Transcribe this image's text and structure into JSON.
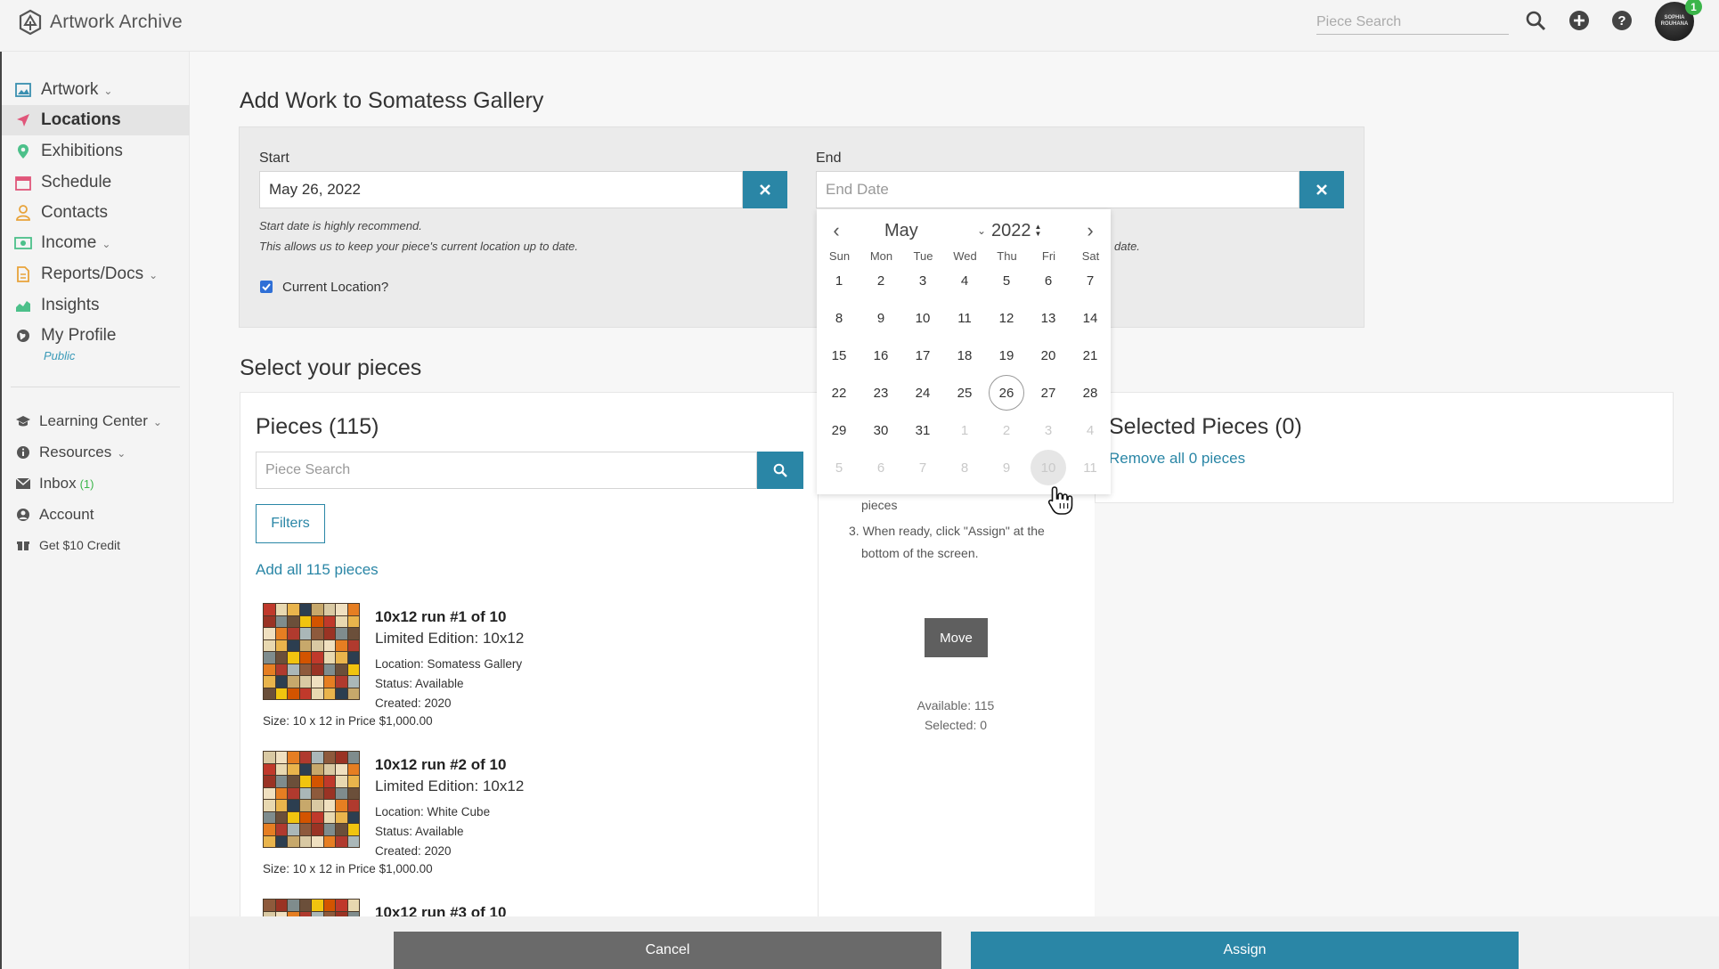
{
  "app": {
    "name": "Artwork Archive"
  },
  "topbar": {
    "search_placeholder": "Piece Search",
    "avatar_text": "SOPHIA ROUHANA",
    "notification_count": "1"
  },
  "sidebar": {
    "items": [
      {
        "label": "Artwork",
        "icon": "image-icon"
      },
      {
        "label": "Locations",
        "icon": "location-arrow-icon"
      },
      {
        "label": "Exhibitions",
        "icon": "map-pin-icon"
      },
      {
        "label": "Schedule",
        "icon": "calendar-icon"
      },
      {
        "label": "Contacts",
        "icon": "user-icon"
      },
      {
        "label": "Income",
        "icon": "money-icon"
      },
      {
        "label": "Reports/Docs",
        "icon": "document-icon"
      },
      {
        "label": "Insights",
        "icon": "chart-icon"
      },
      {
        "label": "My Profile",
        "icon": "globe-icon"
      }
    ],
    "profile_sub": "Public",
    "secondary": [
      {
        "label": "Learning Center",
        "icon": "graduation-cap-icon"
      },
      {
        "label": "Resources",
        "icon": "info-icon"
      },
      {
        "label": "Inbox",
        "icon": "envelope-icon",
        "count": "(1)"
      },
      {
        "label": "Account",
        "icon": "user-circle-icon"
      },
      {
        "label": "Get $10 Credit",
        "icon": "gift-icon"
      }
    ]
  },
  "main": {
    "title": "Add Work to Somatess Gallery",
    "start": {
      "label": "Start",
      "value": "May 26, 2022",
      "hint1": "Start date is highly recommend.",
      "hint2": "This allows us to keep your piece's current location up to date."
    },
    "end": {
      "label": "End",
      "placeholder": "End Date",
      "hint_fragment": "date."
    },
    "current_location_label": "Current Location?",
    "select_title": "Select your pieces",
    "pieces_header": "Pieces (115)",
    "piece_search_placeholder": "Piece Search",
    "filters_label": "Filters",
    "add_all_label": "Add all 115 pieces",
    "pieces": [
      {
        "title": "10x12 run #1 of 10",
        "subtitle": "Limited Edition: 10x12",
        "location": "Location: Somatess Gallery",
        "status": "Status: Available",
        "created": "Created: 2020",
        "size_price": "Size: 10 x 12 in   Price $1,000.00"
      },
      {
        "title": "10x12 run #2 of 10",
        "subtitle": "Limited Edition: 10x12",
        "location": "Location: White Cube",
        "status": "Status: Available",
        "created": "Created: 2020",
        "size_price": "Size: 10 x 12 in   Price $1,000.00"
      },
      {
        "title": "10x12 run #3 of 10"
      }
    ],
    "instructions": {
      "line_fragment": "pieces",
      "step3a": "3. When ready, click \"Assign\" at the",
      "step3b": "bottom of the screen."
    },
    "move_label": "Move",
    "available": "Available: 115",
    "selected": "Selected: 0",
    "selected_header": "Selected Pieces (0)",
    "remove_all_label": "Remove all 0 pieces"
  },
  "datepicker": {
    "month": "May",
    "year": "2022",
    "weekdays": [
      "Sun",
      "Mon",
      "Tue",
      "Wed",
      "Thu",
      "Fri",
      "Sat"
    ],
    "weeks": [
      [
        "1",
        "2",
        "3",
        "4",
        "5",
        "6",
        "7"
      ],
      [
        "8",
        "9",
        "10",
        "11",
        "12",
        "13",
        "14"
      ],
      [
        "15",
        "16",
        "17",
        "18",
        "19",
        "20",
        "21"
      ],
      [
        "22",
        "23",
        "24",
        "25",
        "26",
        "27",
        "28"
      ],
      [
        "29",
        "30",
        "31",
        "1",
        "2",
        "3",
        "4"
      ],
      [
        "5",
        "6",
        "7",
        "8",
        "9",
        "10",
        "11"
      ]
    ],
    "selected_day": "26",
    "hover_day": "10"
  },
  "footer": {
    "cancel_label": "Cancel",
    "assign_label": "Assign"
  },
  "colors": {
    "accent": "#2a86a6",
    "move_button": "#5f5f5f",
    "cancel_button": "#6a6a6a",
    "badge": "#3bb54a"
  }
}
